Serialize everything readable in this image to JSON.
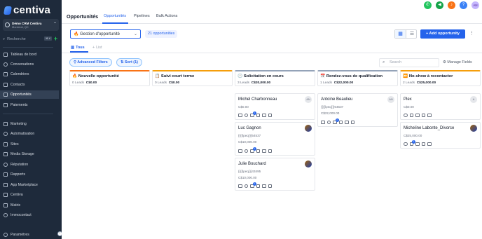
{
  "app": {
    "logo": "centiva"
  },
  "account": {
    "name": "Démo CRM Centiva",
    "location": "Montréal, QC"
  },
  "sidebar": {
    "search_placeholder": "Recherche",
    "search_shortcut": "⌘ K",
    "items": [
      {
        "label": "Tableau de bord",
        "icon": "dashboard-icon"
      },
      {
        "label": "Conversations",
        "icon": "chat-icon"
      },
      {
        "label": "Calendriers",
        "icon": "calendar-icon"
      },
      {
        "label": "Contacts",
        "icon": "contacts-icon"
      },
      {
        "label": "Opportunités",
        "icon": "opportunities-icon",
        "active": true
      },
      {
        "label": "Paiements",
        "icon": "payments-icon"
      },
      {
        "label": "Marketing",
        "icon": "marketing-icon"
      },
      {
        "label": "Automatisation",
        "icon": "automation-icon"
      },
      {
        "label": "Sites",
        "icon": "sites-icon"
      },
      {
        "label": "Media Storage",
        "icon": "media-icon"
      },
      {
        "label": "Réputation",
        "icon": "reputation-icon"
      },
      {
        "label": "Rapports",
        "icon": "reports-icon"
      },
      {
        "label": "App Marketplace",
        "icon": "marketplace-icon"
      },
      {
        "label": "Centiva",
        "icon": "centiva-icon"
      },
      {
        "label": "Matrix",
        "icon": "matrix-icon"
      },
      {
        "label": "Immocontact",
        "icon": "immocontact-icon"
      },
      {
        "label": "Paramètres",
        "icon": "settings-icon"
      }
    ]
  },
  "header": {
    "title": "Opportunités",
    "tabs": [
      "Opportunités",
      "Pipelines",
      "Bulk Actions"
    ],
    "avatar_initials": "AN",
    "colors": {
      "phone": "#22c55e",
      "megaphone": "#16a34a",
      "bell": "#f97316",
      "help": "#3b82f6"
    }
  },
  "toolbar": {
    "pipeline": "🔥 Gestion d'opportunité",
    "count": "21 opportunities",
    "add_label": "+ Add opportunity"
  },
  "view_tabs": [
    "Tous",
    "List"
  ],
  "filters": {
    "advanced": "Advanced Filters",
    "sort": "Sort (1)"
  },
  "search": {
    "placeholder": "Search"
  },
  "manage_fields": "Manage Fields",
  "columns": [
    {
      "title": "🔥 Nouvelle opportunité",
      "leads": "0 Leads",
      "amount": "C$0.00",
      "accent": "#f97316",
      "cards": []
    },
    {
      "title": "📋 Suivi court terme",
      "leads": "0 Leads",
      "amount": "C$0.00",
      "accent": "#f59e0b",
      "cards": []
    },
    {
      "title": "🕐 Solicitation en cours",
      "leads": "3 Leads",
      "amount": "C$20,000.00",
      "accent": "#94a3b8",
      "cards": [
        {
          "name": "Michel Charbonneau",
          "lines": [
            "C$0.00"
          ],
          "avatar": "AN",
          "badge": "1"
        },
        {
          "name": "Luc Gagnon",
          "lines": [
            "{{{{lpeq}}}54537",
            "C$10,000.00"
          ],
          "photo": true,
          "badge": "1"
        },
        {
          "name": "Julie Bouchard",
          "lines": [
            "{{{{lpeq}}}43495",
            "C$10,000.00"
          ],
          "photo": true,
          "badge": "1"
        }
      ]
    },
    {
      "title": "📅 Rendez-vous de qualification",
      "leads": "1 Leads",
      "amount": "C$22,000.00",
      "accent": "#94a3b8",
      "cards": [
        {
          "name": "Antoine Beaulieu",
          "lines": [
            "{{{{lpeq}}}54537",
            "C$22,000.00"
          ],
          "avatar": "AN",
          "badge": "1"
        }
      ]
    },
    {
      "title": "⏩ No-show à recontacter",
      "leads": "2 Leads",
      "amount": "C$25,000.00",
      "accent": "#f59e0b",
      "cards": [
        {
          "name": "Plex",
          "lines": [
            "C$0.00"
          ],
          "avatar": "A"
        },
        {
          "name": "Micheline Labonte_Divorce",
          "lines": [
            "C$25,000.00"
          ],
          "photo": true,
          "badge": "1"
        }
      ]
    }
  ]
}
